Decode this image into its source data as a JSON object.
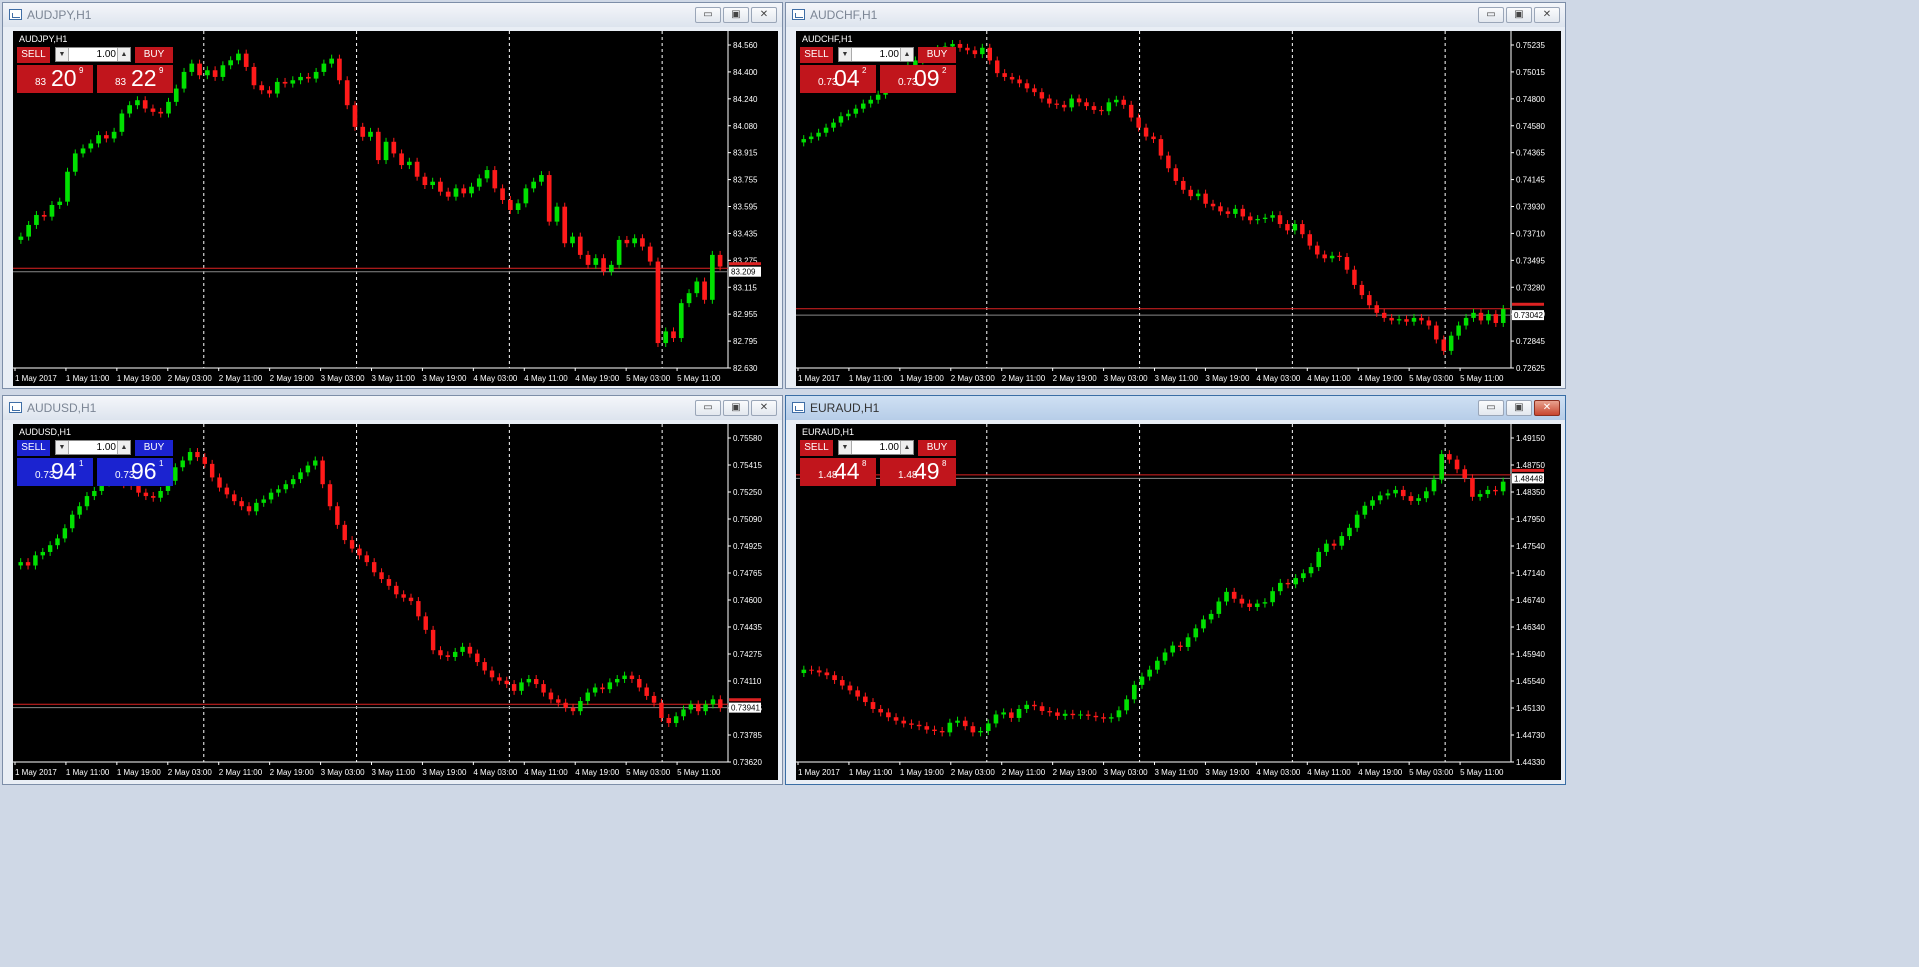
{
  "windows": [
    {
      "id": "audjpy",
      "title": "AUDJPY,H1",
      "label": "AUDJPY,H1",
      "theme": "red",
      "active": false,
      "controls": {
        "minimize": "▭",
        "maximize": "▣",
        "close": "✕"
      },
      "trade": {
        "sell_label": "SELL",
        "buy_label": "BUY",
        "lot": "1.00",
        "sell_pre": "83",
        "sell_big": "20",
        "sell_sup": "9",
        "buy_pre": "83",
        "buy_big": "22",
        "buy_sup": "9"
      },
      "chart_data": {
        "type": "candlestick",
        "symbol": "AUDJPY",
        "timeframe": "H1",
        "ylim": [
          82.63,
          84.62
        ],
        "y_ticks": [
          "84.560",
          "84.400",
          "84.240",
          "84.080",
          "83.915",
          "83.755",
          "83.595",
          "83.435",
          "83.275",
          "83.115",
          "82.955",
          "82.795",
          "82.630"
        ],
        "x_ticks": [
          "1 May 2017",
          "1 May 11:00",
          "1 May 19:00",
          "2 May 03:00",
          "2 May 11:00",
          "2 May 19:00",
          "3 May 03:00",
          "3 May 11:00",
          "3 May 19:00",
          "4 May 03:00",
          "4 May 11:00",
          "4 May 19:00",
          "5 May 03:00",
          "5 May 11:00"
        ],
        "period_separators": [
          "2 May 03:00",
          "3 May 03:00",
          "4 May 03:00",
          "5 May 03:00"
        ],
        "bid_line": 83.209,
        "ask_line": 83.23,
        "price_label": "83.209",
        "closes": [
          83.42,
          83.49,
          83.55,
          83.54,
          83.61,
          83.63,
          83.81,
          83.92,
          83.95,
          83.98,
          84.03,
          84.01,
          84.05,
          84.16,
          84.21,
          84.24,
          84.19,
          84.17,
          84.16,
          84.23,
          84.31,
          84.41,
          84.46,
          84.39,
          84.42,
          84.38,
          84.45,
          84.48,
          84.52,
          84.44,
          84.33,
          84.3,
          84.28,
          84.35,
          84.34,
          84.36,
          84.38,
          84.37,
          84.41,
          84.46,
          84.49,
          84.36,
          84.21,
          84.08,
          84.02,
          84.05,
          83.88,
          83.99,
          83.92,
          83.85,
          83.87,
          83.78,
          83.73,
          83.75,
          83.69,
          83.66,
          83.71,
          83.68,
          83.72,
          83.77,
          83.82,
          83.71,
          83.64,
          83.58,
          83.62,
          83.71,
          83.75,
          83.79,
          83.51,
          83.6,
          83.38,
          83.42,
          83.31,
          83.25,
          83.29,
          83.21,
          83.25,
          83.4,
          83.38,
          83.41,
          83.36,
          83.27,
          82.78,
          82.85,
          82.81,
          83.02,
          83.08,
          83.15,
          83.04,
          83.31,
          83.24
        ]
      }
    },
    {
      "id": "audchf",
      "title": "AUDCHF,H1",
      "label": "AUDCHF,H1",
      "theme": "red",
      "active": false,
      "controls": {
        "minimize": "▭",
        "maximize": "▣",
        "close": "✕"
      },
      "trade": {
        "sell_label": "SELL",
        "buy_label": "BUY",
        "lot": "1.00",
        "sell_pre": "0.73",
        "sell_big": "04",
        "sell_sup": "2",
        "buy_pre": "0.73",
        "buy_big": "09",
        "buy_sup": "2"
      },
      "chart_data": {
        "type": "candlestick",
        "symbol": "AUDCHF",
        "timeframe": "H1",
        "ylim": [
          0.72625,
          0.75235
        ],
        "y_ticks": [
          "0.75235",
          "0.75015",
          "0.74800",
          "0.74580",
          "0.74365",
          "0.74145",
          "0.73930",
          "0.73710",
          "0.73495",
          "0.73280",
          "0.73060",
          "0.72845",
          "0.72625"
        ],
        "x_ticks": [
          "1 May 2017",
          "1 May 11:00",
          "1 May 19:00",
          "2 May 03:00",
          "2 May 11:00",
          "2 May 19:00",
          "3 May 03:00",
          "3 May 11:00",
          "3 May 19:00",
          "4 May 03:00",
          "4 May 11:00",
          "4 May 19:00",
          "5 May 03:00",
          "5 May 11:00"
        ],
        "period_separators": [
          "2 May 03:00",
          "3 May 03:00",
          "4 May 03:00",
          "5 May 03:00"
        ],
        "bid_line": 0.73042,
        "ask_line": 0.73092,
        "price_label": "0.73042",
        "closes": [
          0.7443,
          0.7445,
          0.7448,
          0.7452,
          0.7456,
          0.7461,
          0.7463,
          0.7467,
          0.7471,
          0.7474,
          0.7478,
          0.7483,
          0.7488,
          0.7495,
          0.7501,
          0.7505,
          0.7509,
          0.7512,
          0.7514,
          0.7516,
          0.7518,
          0.7515,
          0.7513,
          0.751,
          0.7515,
          0.7505,
          0.7495,
          0.7492,
          0.749,
          0.7487,
          0.7483,
          0.748,
          0.7475,
          0.7471,
          0.747,
          0.7468,
          0.7475,
          0.7472,
          0.7469,
          0.7466,
          0.7465,
          0.7472,
          0.7474,
          0.747,
          0.746,
          0.7452,
          0.7445,
          0.7443,
          0.743,
          0.742,
          0.741,
          0.7403,
          0.7398,
          0.74,
          0.7392,
          0.739,
          0.7386,
          0.7384,
          0.7388,
          0.7382,
          0.7379,
          0.738,
          0.7381,
          0.7383,
          0.7376,
          0.7371,
          0.7376,
          0.7368,
          0.7359,
          0.7352,
          0.7349,
          0.7351,
          0.735,
          0.734,
          0.7328,
          0.732,
          0.7312,
          0.7306,
          0.7302,
          0.73,
          0.7301,
          0.7299,
          0.7302,
          0.73,
          0.7296,
          0.7285,
          0.7276,
          0.7288,
          0.7296,
          0.7302,
          0.7306,
          0.73,
          0.7305,
          0.7298,
          0.7309
        ]
      }
    },
    {
      "id": "audusd",
      "title": "AUDUSD,H1",
      "label": "AUDUSD,H1",
      "theme": "blue",
      "active": false,
      "controls": {
        "minimize": "▭",
        "maximize": "▣",
        "close": "✕"
      },
      "trade": {
        "sell_label": "SELL",
        "buy_label": "BUY",
        "lot": "1.00",
        "sell_pre": "0.73",
        "sell_big": "94",
        "sell_sup": "1",
        "buy_pre": "0.73",
        "buy_big": "96",
        "buy_sup": "1"
      },
      "chart_data": {
        "type": "candlestick",
        "symbol": "AUDUSD",
        "timeframe": "H1",
        "ylim": [
          0.7362,
          0.7558
        ],
        "y_ticks": [
          "0.75580",
          "0.75415",
          "0.75250",
          "0.75090",
          "0.74925",
          "0.74765",
          "0.74600",
          "0.74435",
          "0.74275",
          "0.74110",
          "0.73945",
          "0.73785",
          "0.73620"
        ],
        "x_ticks": [
          "1 May 2017",
          "1 May 11:00",
          "1 May 19:00",
          "2 May 03:00",
          "2 May 11:00",
          "2 May 19:00",
          "3 May 03:00",
          "3 May 11:00",
          "3 May 19:00",
          "4 May 03:00",
          "4 May 11:00",
          "4 May 19:00",
          "5 May 03:00",
          "5 May 11:00"
        ],
        "period_separators": [
          "2 May 03:00",
          "3 May 03:00",
          "4 May 03:00",
          "5 May 03:00"
        ],
        "bid_line": 0.73941,
        "ask_line": 0.73961,
        "price_label": "0.73941",
        "closes": [
          0.748,
          0.7478,
          0.7484,
          0.7486,
          0.749,
          0.7494,
          0.75,
          0.7508,
          0.7513,
          0.7519,
          0.7522,
          0.7527,
          0.753,
          0.7528,
          0.7526,
          0.7525,
          0.7521,
          0.7519,
          0.7518,
          0.7522,
          0.7528,
          0.7536,
          0.754,
          0.7545,
          0.7542,
          0.7538,
          0.753,
          0.7524,
          0.752,
          0.7516,
          0.7513,
          0.751,
          0.7515,
          0.7517,
          0.7521,
          0.7523,
          0.7526,
          0.7529,
          0.7533,
          0.7537,
          0.754,
          0.7526,
          0.7513,
          0.7502,
          0.7493,
          0.7488,
          0.7484,
          0.748,
          0.7474,
          0.747,
          0.7466,
          0.7461,
          0.7459,
          0.7457,
          0.7448,
          0.744,
          0.7428,
          0.7425,
          0.7424,
          0.7427,
          0.743,
          0.7426,
          0.7421,
          0.7416,
          0.7412,
          0.741,
          0.7408,
          0.7404,
          0.7409,
          0.7411,
          0.7408,
          0.7403,
          0.7399,
          0.7397,
          0.7394,
          0.7392,
          0.7398,
          0.7403,
          0.7406,
          0.7405,
          0.7409,
          0.7411,
          0.7413,
          0.7411,
          0.7406,
          0.7401,
          0.7397,
          0.7388,
          0.7385,
          0.7389,
          0.7393,
          0.7396,
          0.7392,
          0.7396,
          0.7399,
          0.7394
        ]
      }
    },
    {
      "id": "euraud",
      "title": "EURAUD,H1",
      "label": "EURAUD,H1",
      "theme": "red",
      "active": true,
      "controls": {
        "minimize": "▭",
        "maximize": "▣",
        "close": "✕"
      },
      "trade": {
        "sell_label": "SELL",
        "buy_label": "BUY",
        "lot": "1.00",
        "sell_pre": "1.48",
        "sell_big": "44",
        "sell_sup": "8",
        "buy_pre": "1.48",
        "buy_big": "49",
        "buy_sup": "8"
      },
      "chart_data": {
        "type": "candlestick",
        "symbol": "EURAUD",
        "timeframe": "H1",
        "ylim": [
          1.4433,
          1.4915
        ],
        "y_ticks": [
          "1.49150",
          "1.48750",
          "1.48350",
          "1.47950",
          "1.47540",
          "1.47140",
          "1.46740",
          "1.46340",
          "1.45940",
          "1.45540",
          "1.45130",
          "1.44730",
          "1.44330"
        ],
        "x_ticks": [
          "1 May 2017",
          "1 May 11:00",
          "1 May 19:00",
          "2 May 03:00",
          "2 May 11:00",
          "2 May 19:00",
          "3 May 03:00",
          "3 May 11:00",
          "3 May 19:00",
          "4 May 03:00",
          "4 May 11:00",
          "4 May 19:00",
          "5 May 03:00",
          "5 May 11:00"
        ],
        "period_separators": [
          "2 May 03:00",
          "3 May 03:00",
          "4 May 03:00",
          "5 May 03:00"
        ],
        "bid_line": 1.48448,
        "ask_line": 1.48498,
        "price_label": "1.48448",
        "closes": [
          1.4567,
          1.4566,
          1.4563,
          1.4559,
          1.4552,
          1.4544,
          1.4537,
          1.4528,
          1.452,
          1.451,
          1.4505,
          1.4498,
          1.4493,
          1.4489,
          1.4487,
          1.4485,
          1.448,
          1.4478,
          1.4476,
          1.449,
          1.4493,
          1.4485,
          1.4476,
          1.4478,
          1.4489,
          1.4502,
          1.4505,
          1.4497,
          1.451,
          1.4516,
          1.4514,
          1.4507,
          1.4505,
          1.45,
          1.4503,
          1.4501,
          1.4502,
          1.45,
          1.4498,
          1.4496,
          1.4498,
          1.4508,
          1.4524,
          1.4545,
          1.4557,
          1.4567,
          1.458,
          1.4592,
          1.4602,
          1.46,
          1.4614,
          1.4627,
          1.464,
          1.4648,
          1.4666,
          1.468,
          1.467,
          1.4663,
          1.4658,
          1.4663,
          1.4665,
          1.4681,
          1.4693,
          1.4691,
          1.47,
          1.4707,
          1.4716,
          1.4738,
          1.475,
          1.4747,
          1.4761,
          1.4773,
          1.4792,
          1.4805,
          1.4813,
          1.482,
          1.4823,
          1.4828,
          1.4819,
          1.4812,
          1.4816,
          1.4826,
          1.4843,
          1.488,
          1.4872,
          1.4858,
          1.4845,
          1.4818,
          1.4822,
          1.4828,
          1.4826,
          1.484
        ]
      }
    }
  ]
}
